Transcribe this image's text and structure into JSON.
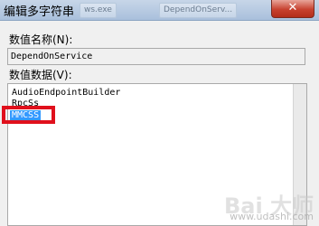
{
  "window": {
    "title": "编辑多字符串",
    "background_tabs": [
      "ws.exe",
      "DependOnServ..."
    ],
    "close_glyph": "✕"
  },
  "fields": {
    "value_name_label": "数值名称(N):",
    "value_name": "DependOnService",
    "value_data_label": "数值数据(V):",
    "value_data_lines": [
      "AudioEndpointBuilder",
      "RpcSs",
      "MMCSS"
    ],
    "selected_line": "MMCSS"
  },
  "watermark": {
    "logo": "Bai 大师",
    "url": "www.udashi.com"
  },
  "colors": {
    "highlight_border": "#e0101c",
    "selection": "#3399ff",
    "titlebar": "#b7cbe3"
  }
}
